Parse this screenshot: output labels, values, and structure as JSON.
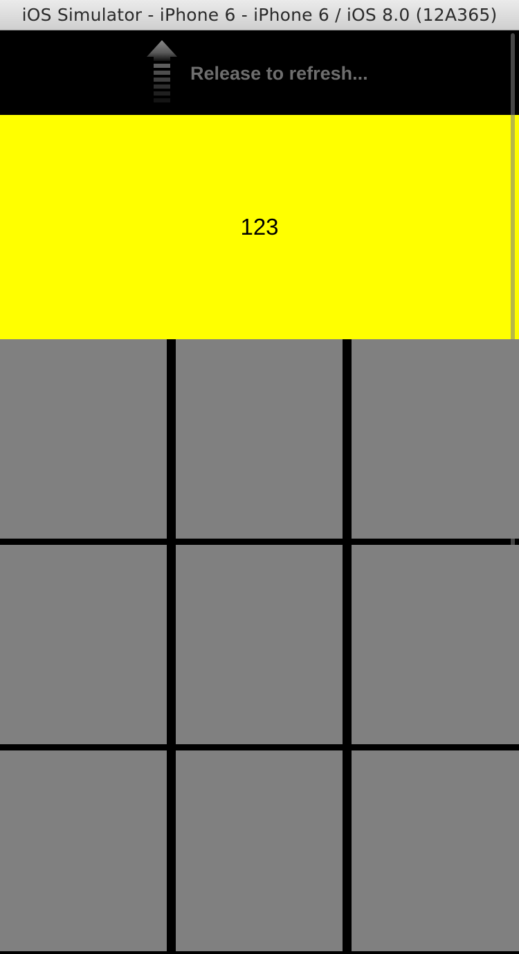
{
  "window": {
    "title": "iOS Simulator - iPhone 6 - iPhone 6 / iOS 8.0 (12A365)"
  },
  "refresh_control": {
    "label": "Release to refresh...",
    "icon": "up-arrow-icon"
  },
  "header": {
    "value": "123",
    "background_color": "#ffff00"
  },
  "collection": {
    "cell_color": "#808080",
    "cells": [
      {
        "label": ""
      },
      {
        "label": ""
      },
      {
        "label": ""
      },
      {
        "label": ""
      },
      {
        "label": ""
      },
      {
        "label": ""
      },
      {
        "label": ""
      },
      {
        "label": ""
      },
      {
        "label": ""
      }
    ]
  }
}
